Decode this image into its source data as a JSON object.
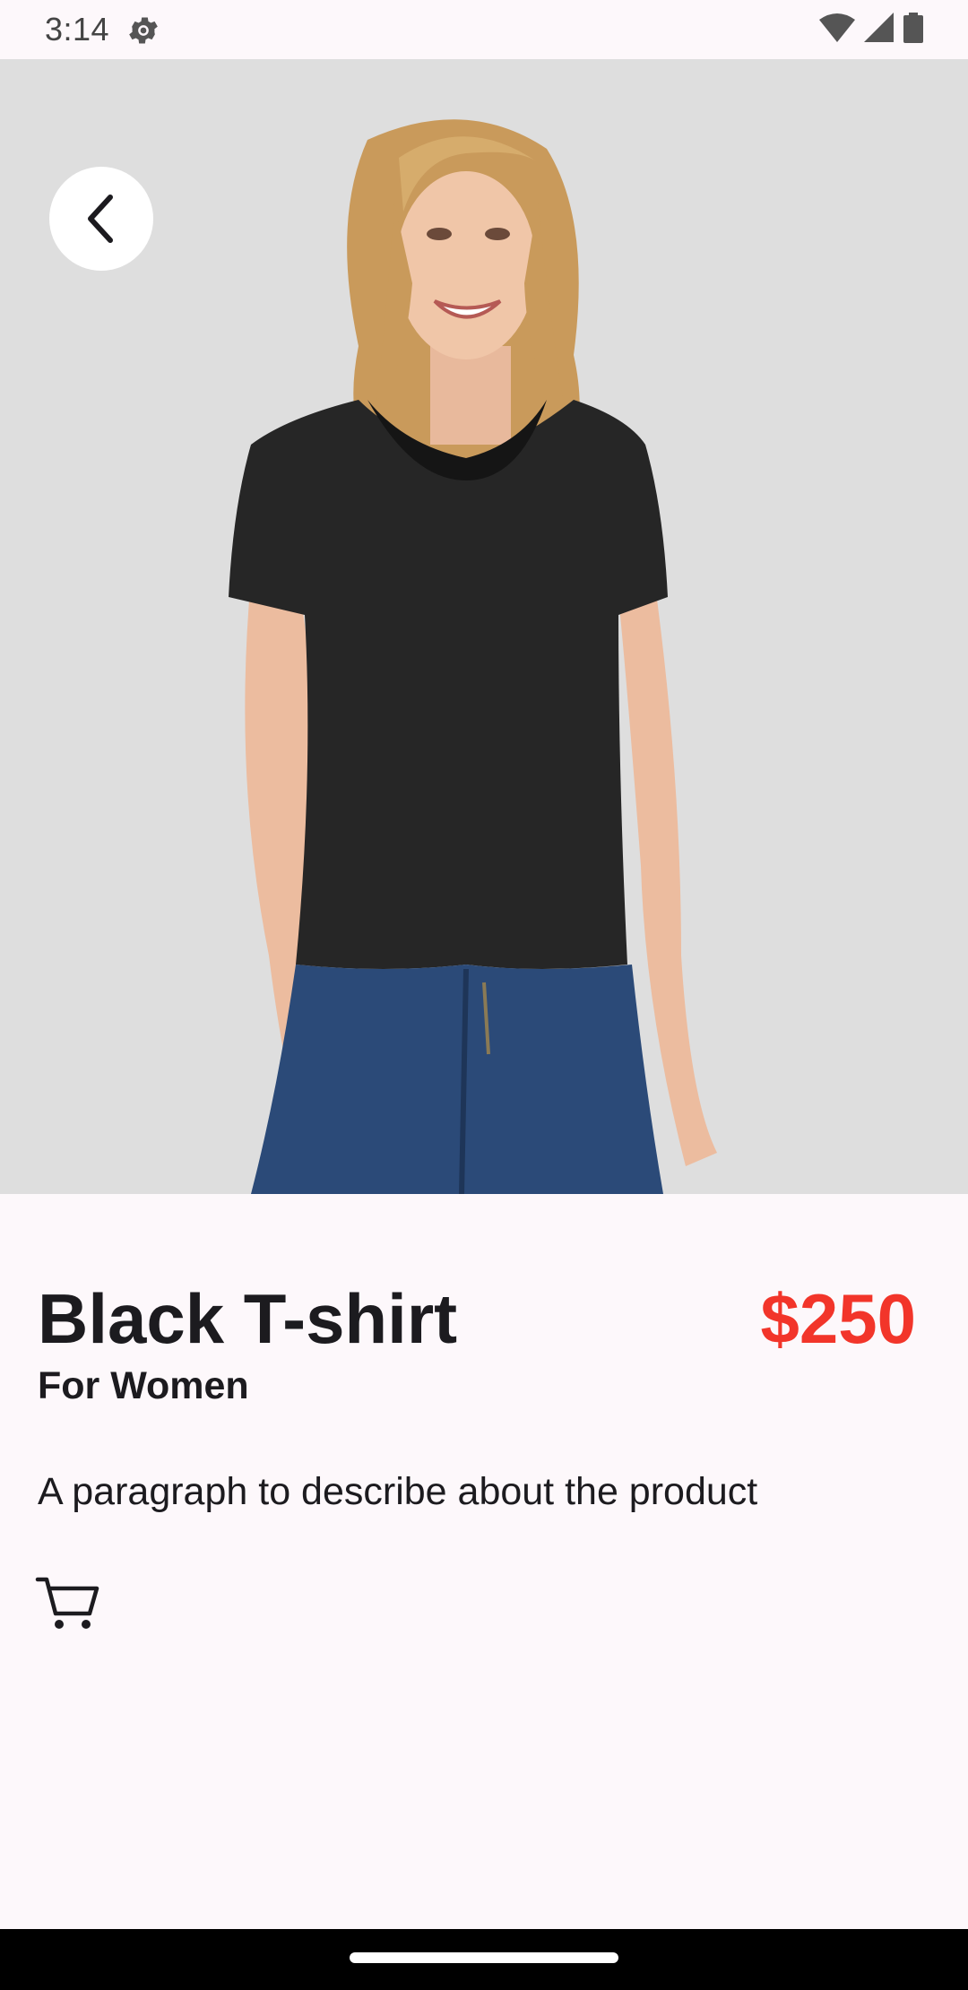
{
  "status_bar": {
    "time": "3:14"
  },
  "product": {
    "name": "Black T-shirt",
    "price": "$250",
    "subtitle": "For Women",
    "description": "A paragraph to describe about the product"
  },
  "icons": {
    "back": "chevron-left-icon",
    "cart": "cart-icon",
    "settings": "gear-icon",
    "wifi": "wifi-icon",
    "signal": "signal-icon",
    "battery": "battery-icon"
  },
  "colors": {
    "background": "#fdf8fb",
    "price": "#f2352a",
    "text": "#1c1b1f",
    "image_background": "#dedede"
  }
}
